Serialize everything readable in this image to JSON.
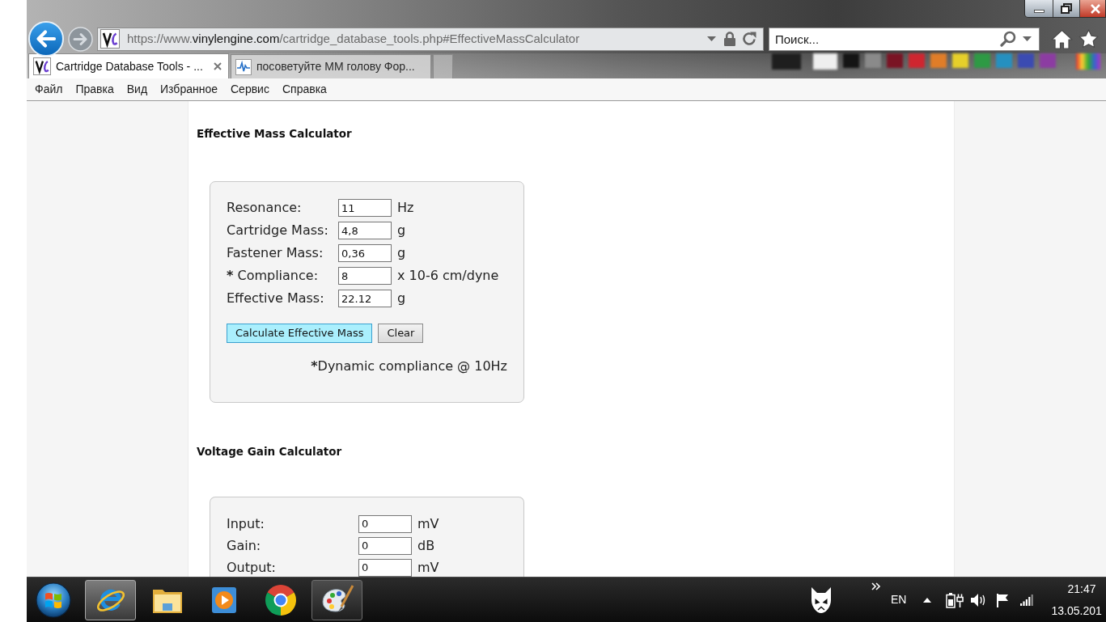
{
  "browser": {
    "address": {
      "scheme": "https://www.",
      "domain": "vinylengine.com",
      "path": "/cartridge_database_tools.php#EffectiveMassCalculator"
    },
    "search": {
      "placeholder": "Поиск..."
    }
  },
  "tabs": [
    {
      "title": "Cartridge Database Tools - ...",
      "kind": "logo",
      "selected": true
    },
    {
      "title": "посоветуйте MM голову Фор...",
      "kind": "wave",
      "selected": false
    }
  ],
  "menu": [
    "Файл",
    "Правка",
    "Вид",
    "Избранное",
    "Сервис",
    "Справка"
  ],
  "sections": [
    {
      "title": "Effective Mass Calculator",
      "fields": [
        {
          "label": "Resonance:",
          "value": "11",
          "unit": "Hz"
        },
        {
          "label": "Cartridge Mass:",
          "value": "4,8",
          "unit": "g"
        },
        {
          "label": "Fastener Mass:",
          "value": "0,36",
          "unit": "g"
        },
        {
          "marker": "*",
          "label": "Compliance:",
          "value": "8",
          "unit": "x 10-6 cm/dyne"
        },
        {
          "label": "Effective Mass:",
          "value": "22.12",
          "unit": "g"
        }
      ],
      "buttons": [
        {
          "label": "Calculate Effective Mass",
          "kind": "primary"
        },
        {
          "label": "Clear",
          "kind": "secondary"
        }
      ],
      "note": {
        "marker": "*",
        "text": "Dynamic compliance @ 10Hz"
      }
    },
    {
      "title": "Voltage Gain Calculator",
      "fields": [
        {
          "label": "Input:",
          "value": "0",
          "unit": "mV"
        },
        {
          "label": "Gain:",
          "value": "0",
          "unit": "dB"
        },
        {
          "label": "Output:",
          "value": "0",
          "unit": "mV"
        }
      ]
    }
  ],
  "taskbar": {
    "apps": [
      {
        "kind": "ie",
        "open": true,
        "focused": true
      },
      {
        "kind": "folder",
        "open": false,
        "focused": false
      },
      {
        "kind": "player",
        "open": false,
        "focused": false
      },
      {
        "kind": "chrome",
        "open": false,
        "focused": false
      },
      {
        "kind": "paint",
        "open": true,
        "focused": false
      }
    ],
    "tray": {
      "language": "EN",
      "time": "21:47",
      "date": "13.05.201"
    }
  }
}
